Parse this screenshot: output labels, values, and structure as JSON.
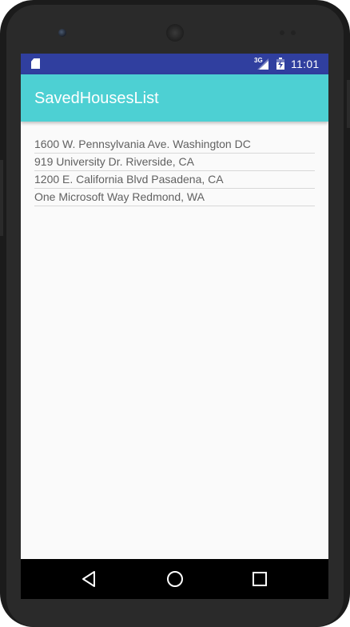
{
  "status_bar": {
    "network_label": "3G",
    "time": "11:01",
    "icons": [
      "sd-card-icon",
      "signal-icon",
      "battery-icon"
    ]
  },
  "app_bar": {
    "title": "SavedHousesList",
    "color": "#4dd0d3"
  },
  "houses": [
    "1600 W. Pennsylvania Ave. Washington DC",
    "919 University Dr. Riverside, CA",
    "1200 E. California Blvd Pasadena, CA",
    "One Microsoft Way Redmond, WA"
  ],
  "nav_bar": {
    "buttons": [
      "back-icon",
      "home-icon",
      "recents-icon"
    ]
  },
  "colors": {
    "status_bar": "#303f9f",
    "app_bar": "#4dd0d3",
    "background": "#fafafa"
  }
}
